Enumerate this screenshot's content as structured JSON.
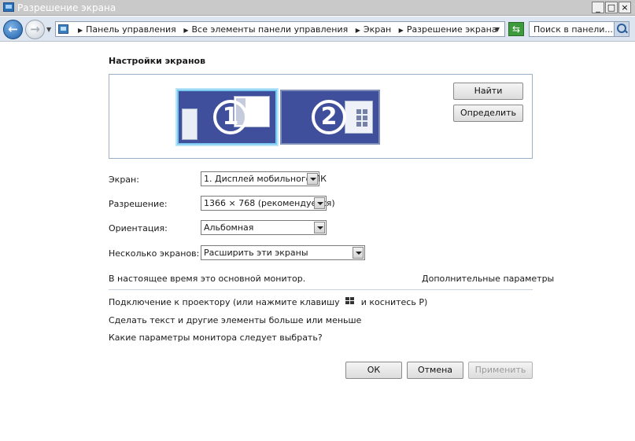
{
  "window": {
    "title": "Разрешение экрана"
  },
  "address_bar": {
    "breadcrumbs": [
      "Панель управления",
      "Все элементы панели управления",
      "Экран",
      "Разрешение экрана"
    ],
    "search_placeholder": "Поиск в панели..."
  },
  "main": {
    "section_title": "Настройки экранов",
    "monitors": [
      {
        "number": "1",
        "selected": true
      },
      {
        "number": "2",
        "selected": false
      }
    ],
    "find_button": "Найти",
    "identify_button": "Определить",
    "fields": {
      "display_label": "Экран:",
      "display_value": "1. Дисплей мобильного ПК",
      "resolution_label": "Разрешение:",
      "resolution_value": "1366 × 768 (рекомендуется)",
      "orientation_label": "Ориентация:",
      "orientation_value": "Альбомная",
      "multiple_label": "Несколько экранов:",
      "multiple_value": "Расширить эти экраны"
    },
    "status_text": "В настоящее время это основной монитор.",
    "advanced_link": "Дополнительные параметры",
    "projector_link_before": "Подключение к проектору (или нажмите клавишу",
    "projector_link_after": "и коснитесь P)",
    "text_size_link": "Сделать текст и другие элементы больше или меньше",
    "help_link": "Какие параметры монитора следует выбрать?"
  },
  "footer": {
    "ok": "ОК",
    "cancel": "Отмена",
    "apply": "Применить"
  },
  "colors": {
    "monitor_fill": "#3f4f9c",
    "selection_outline": "#79c8ef",
    "refresh_green": "#3d9a3d"
  }
}
